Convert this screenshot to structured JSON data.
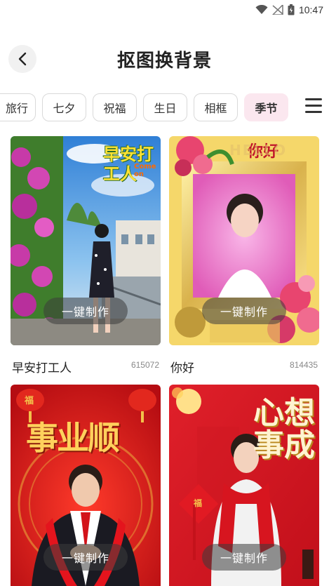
{
  "status_bar": {
    "time": "10:47"
  },
  "header": {
    "title": "抠图换背景"
  },
  "tabs": [
    {
      "label": "旅行",
      "active": false
    },
    {
      "label": "七夕",
      "active": false
    },
    {
      "label": "祝福",
      "active": false
    },
    {
      "label": "生日",
      "active": false
    },
    {
      "label": "相框",
      "active": false
    },
    {
      "label": "季节",
      "active": true
    }
  ],
  "cards": [
    {
      "title": "早安打工人",
      "count": "615072",
      "button": "一键制作",
      "overlay": "早安打工人",
      "overlay_sub": "Come on"
    },
    {
      "title": "你好",
      "count": "814435",
      "button": "一键制作",
      "overlay": "你好",
      "overlay_sub": "HELLO"
    },
    {
      "title": "",
      "count": "",
      "button": "一键制作",
      "overlay": "事业顺",
      "overlay_sub": "福"
    },
    {
      "title": "",
      "count": "",
      "button": "一键制作",
      "overlay": "心想事成",
      "overlay_sub": "福"
    }
  ],
  "colors": {
    "active_tab_bg": "#fbe7ef",
    "accent_red": "#d8141c",
    "gold": "#f3c24a"
  }
}
